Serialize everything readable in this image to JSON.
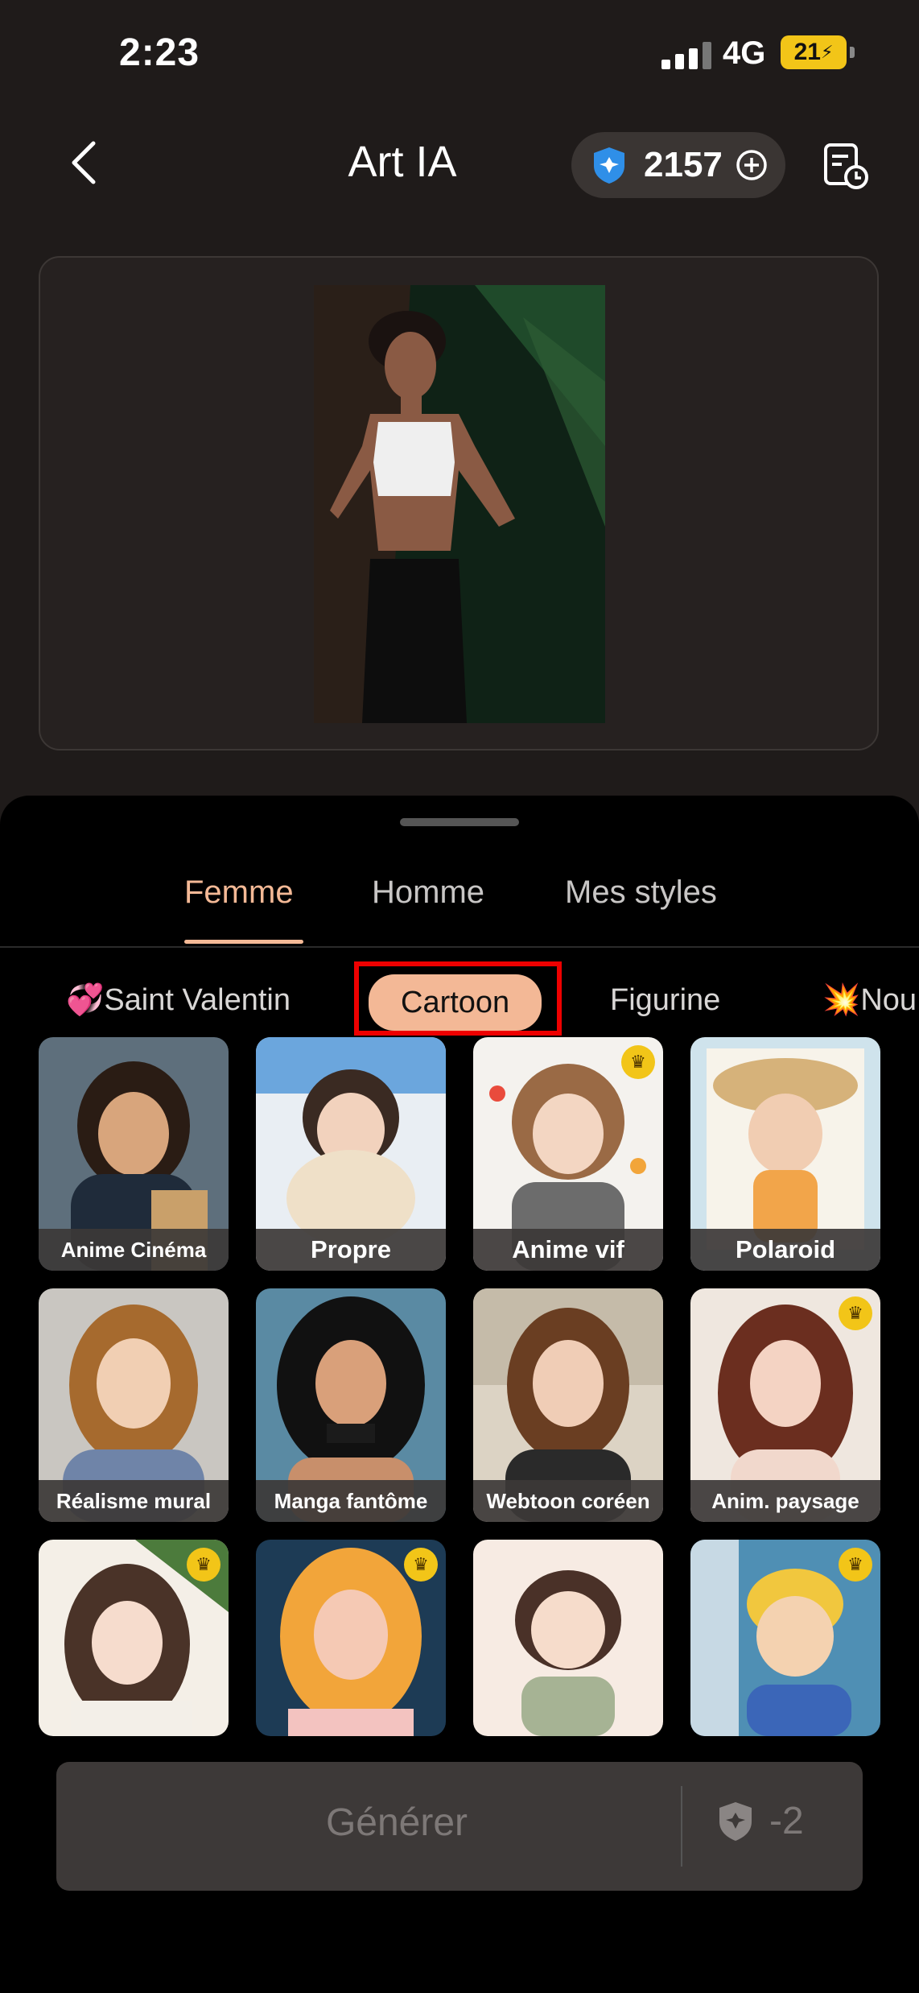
{
  "status_bar": {
    "time": "2:23",
    "network": "4G",
    "battery": "21"
  },
  "header": {
    "title": "Art IA",
    "credits": "2157"
  },
  "tabs": [
    {
      "label": "Femme",
      "active": true
    },
    {
      "label": "Homme",
      "active": false
    },
    {
      "label": "Mes styles",
      "active": false
    }
  ],
  "chips": [
    {
      "emoji": "💞",
      "label": "Saint Valentin"
    },
    {
      "emoji": "",
      "label": "Cartoon"
    },
    {
      "emoji": "",
      "label": "Figurine"
    },
    {
      "emoji": "💥",
      "label": "Nou"
    }
  ],
  "styles": [
    {
      "label": "Anime Cinéma",
      "premium": false
    },
    {
      "label": "Propre",
      "premium": false
    },
    {
      "label": "Anime vif",
      "premium": true
    },
    {
      "label": "Polaroid",
      "premium": false
    },
    {
      "label": "Réalisme mural",
      "premium": false
    },
    {
      "label": "Manga fantôme",
      "premium": false
    },
    {
      "label": "Webtoon coréen",
      "premium": false
    },
    {
      "label": "Anim. paysage",
      "premium": true
    },
    {
      "label": "",
      "premium": true
    },
    {
      "label": "",
      "premium": true
    },
    {
      "label": "",
      "premium": false
    },
    {
      "label": "",
      "premium": true
    }
  ],
  "generate": {
    "label": "Générer",
    "cost": "-2"
  },
  "colors": {
    "accent": "#f4b996",
    "background": "#1f1b1a",
    "crown": "#f2c518",
    "highlight_frame": "#ee0000"
  }
}
